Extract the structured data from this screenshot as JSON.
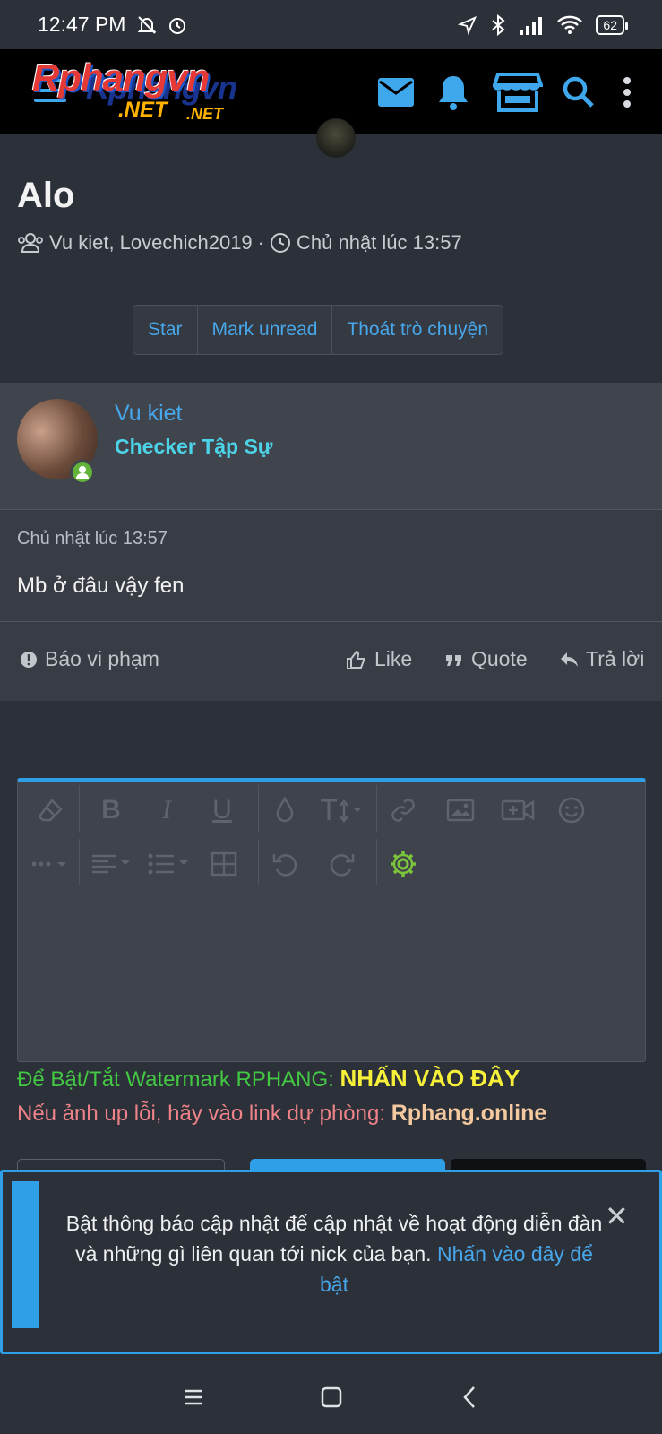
{
  "status_bar": {
    "time": "12:47 PM",
    "battery": "62"
  },
  "header": {
    "logo_main": "Rphangvn",
    "logo_ghost": "Rphangvn",
    "logo_net_1": ".NET",
    "logo_net_2": ".NET",
    "accent": "#47a7eb"
  },
  "conversation": {
    "title": "Alo",
    "participants": "Vu kiet, Lovechich2019",
    "separator": "·",
    "date": "Chủ nhật lúc 13:57",
    "buttons": {
      "star": "Star",
      "mark_unread": "Mark unread",
      "leave": "Thoát trò chuyện"
    }
  },
  "message": {
    "username": "Vu kiet",
    "user_title": "Checker Tập Sự",
    "date": "Chủ nhật lúc 13:57",
    "body": "Mb ở đâu vậy fen",
    "actions": {
      "report": "Báo vi phạm",
      "like": "Like",
      "quote": "Quote",
      "reply": "Trả lời"
    }
  },
  "editor": {
    "toolbar_icons": [
      "eraser-icon",
      "bold-icon",
      "italic-icon",
      "underline-icon",
      "color-drop-icon",
      "font-size-icon",
      "link-icon",
      "image-icon",
      "video-icon",
      "emoji-icon",
      "more-icon",
      "align-icon",
      "list-icon",
      "table-icon",
      "undo-icon",
      "redo-icon",
      "settings-icon"
    ],
    "bold": "B",
    "italic": "I",
    "underline": "U"
  },
  "notices": {
    "watermark_text": "Để Bật/Tắt Watermark RPHANG: ",
    "watermark_link": "NHẤN VÀO ĐÂY",
    "backup_text": "Nếu ảnh up lỗi, hãy vào link dự phòng: ",
    "backup_link": "Rphang.online"
  },
  "push_banner": {
    "text": "Bật thông báo cập nhật để cập nhật về hoạt động diễn đàn và những gì liên quan tới nick của bạn. ",
    "link": "Nhấn vào đây để bật",
    "close": "✕"
  }
}
